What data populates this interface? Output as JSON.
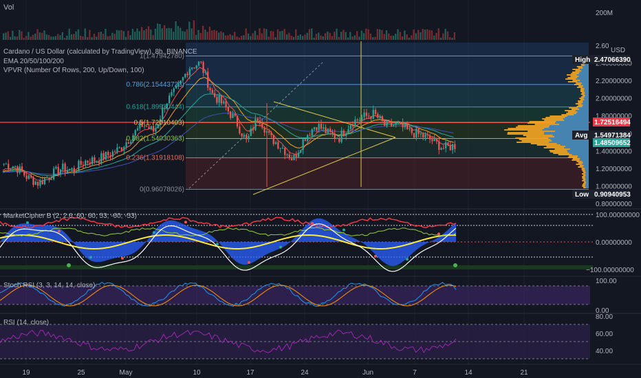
{
  "vol_label": "Vol",
  "vol_axis": [
    "200M"
  ],
  "main": {
    "title": "Cardano / US Dollar (calculated by TradingView), 8h, BINANCE",
    "ema": "EMA 20/50/100/200",
    "vpvr": "VPVR (Number Of Rows, 200, Up/Down, 100)",
    "currency": "USD",
    "y_ticks": [
      "2.60",
      "2.40000000",
      "2.20000000",
      "2.00000000",
      "1.80000000",
      "1.60000000",
      "1.40000000",
      "1.20000000",
      "1.00000000",
      "0.80000000"
    ],
    "high_label": "High",
    "high_value": "2.47066390",
    "last_value": "1.72516494",
    "avg_label": "Avg",
    "avg_value": "1.54971384",
    "current_value": "1.48509652",
    "low_label": "Low",
    "low_value": "0.90940953",
    "fib": [
      {
        "label": "1(1.47942780)",
        "price": 2.48
      },
      {
        "label": "0.786(2.15443723)",
        "price": 2.154
      },
      {
        "label": "0.618(1.89930444)",
        "price": 1.899
      },
      {
        "label": "0.5(1.72010403)",
        "price": 1.72
      },
      {
        "label": "0.382(1.54030363)",
        "price": 1.54
      },
      {
        "label": "0.236(1.31918108)",
        "price": 1.319
      },
      {
        "label": "0(0.96078026)",
        "price": 0.961
      }
    ]
  },
  "mcb": {
    "label": "MarketCipher B (2, 2.6, 60, 60, 53, -60, -53)",
    "ticks": [
      "100.00000000",
      "0.00000000",
      "−100.00000000"
    ]
  },
  "stoch": {
    "label": "Stoch RSI (3, 3, 14, 14, close)",
    "ticks": [
      "100.00",
      "0.00"
    ]
  },
  "rsi": {
    "label": "RSI (14, close)",
    "ticks": [
      "80.00",
      "60.00",
      "40.00"
    ]
  },
  "x_ticks": [
    "19",
    "25",
    "May",
    "10",
    "17",
    "24",
    "Jun",
    "7",
    "14",
    "21"
  ],
  "colors": {
    "bg": "#131722",
    "up": "#26a69a",
    "down": "#ef5350",
    "fib_yellow": "#e0c94a",
    "profile": "#f5a623",
    "profile_up": "#2a7fc9",
    "rsi": "#9c27b0",
    "stoch_k": "#2196f3",
    "stoch_d": "#ff9800"
  },
  "chart_data": {
    "type": "candlestick",
    "symbol": "ADA/USD",
    "interval": "8h",
    "y_range": [
      0.8,
      2.6
    ],
    "approx_closes": [
      1.25,
      1.22,
      1.1,
      1.03,
      1.12,
      1.2,
      1.18,
      1.28,
      1.3,
      1.35,
      1.42,
      1.56,
      1.7,
      1.62,
      1.95,
      2.1,
      2.35,
      2.4,
      2.05,
      1.92,
      1.75,
      1.5,
      1.8,
      1.55,
      1.45,
      1.3,
      1.55,
      1.7,
      1.6,
      1.55,
      1.72,
      1.78,
      1.82,
      1.68,
      1.7,
      1.62,
      1.58,
      1.52,
      1.43,
      1.46
    ],
    "levels": {
      "high": 2.4706639,
      "low": 0.90940953,
      "avg": 1.54971384,
      "current": 1.48509652,
      "last": 1.72516494
    },
    "mcb_range": [
      -100,
      100
    ],
    "rsi_levels": [
      80,
      60,
      40
    ]
  }
}
